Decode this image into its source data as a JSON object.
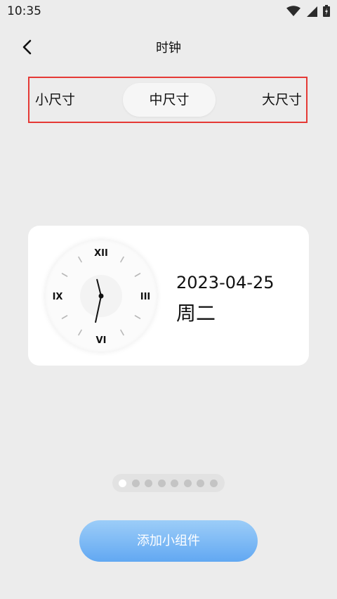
{
  "status_bar": {
    "time": "10:35",
    "icons": [
      "wifi-icon",
      "signal-icon",
      "battery-icon"
    ]
  },
  "header": {
    "back_icon": "chevron-left-icon",
    "title": "时钟"
  },
  "size_tabs": {
    "items": [
      {
        "label": "小尺寸",
        "selected": false
      },
      {
        "label": "中尺寸",
        "selected": true
      },
      {
        "label": "大尺寸",
        "selected": false
      }
    ],
    "highlight_color": "#e53935"
  },
  "widget": {
    "clock": {
      "numerals": {
        "top": "XII",
        "right": "III",
        "bottom": "VI",
        "left": "IX"
      },
      "time_shown": "11:32"
    },
    "date": "2023-04-25",
    "weekday": "周二"
  },
  "pager": {
    "total": 8,
    "active_index": 0
  },
  "add_button": {
    "label": "添加小组件",
    "color_top": "#9ccdf8",
    "color_bottom": "#62a8f2"
  }
}
